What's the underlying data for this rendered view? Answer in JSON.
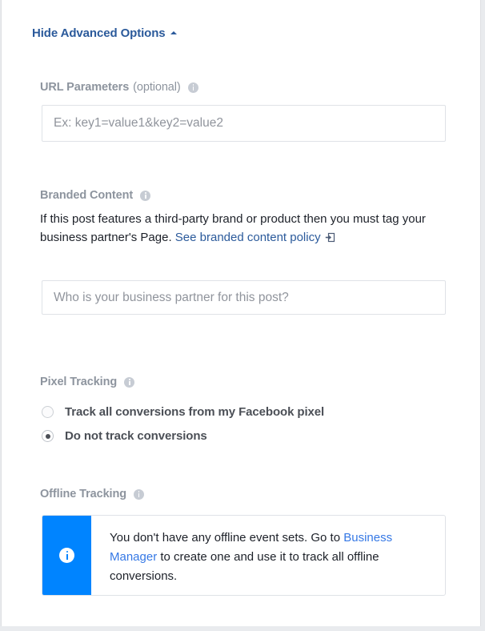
{
  "panel": {
    "background": "#ffffff",
    "page_background": "#e9ebee",
    "border_color": "#dddfe2"
  },
  "header": {
    "label": "Hide Advanced Options",
    "link_color": "#2b5a9b",
    "caret": "caret-up"
  },
  "url_parameters": {
    "label": "URL Parameters",
    "optional_suffix": "(optional)",
    "info_icon": "info-icon",
    "placeholder": "Ex: key1=value1&key2=value2",
    "value": ""
  },
  "branded_content": {
    "label": "Branded Content",
    "info_icon": "info-icon",
    "description_part1": "If this post features a third-party brand or product then you must tag your business partner's Page. ",
    "link_text": "See branded content policy",
    "link_icon": "external-link-icon",
    "link_color": "#2b5a9b",
    "placeholder": "Who is your business partner for this post?",
    "value": ""
  },
  "pixel_tracking": {
    "label": "Pixel Tracking",
    "info_icon": "info-icon",
    "options": [
      {
        "label": "Track all conversions from my Facebook pixel",
        "selected": false
      },
      {
        "label": "Do not track conversions",
        "selected": true
      }
    ]
  },
  "offline_tracking": {
    "label": "Offline Tracking",
    "info_icon": "info-icon",
    "notice": {
      "icon": "info-circle-icon",
      "accent_color": "#0084ff",
      "text_part1": "You don't have any offline event sets. Go to ",
      "link_text": "Business Manager",
      "link_color": "#3578e5",
      "text_part2": " to create one and use it to track all offline conversions."
    }
  }
}
